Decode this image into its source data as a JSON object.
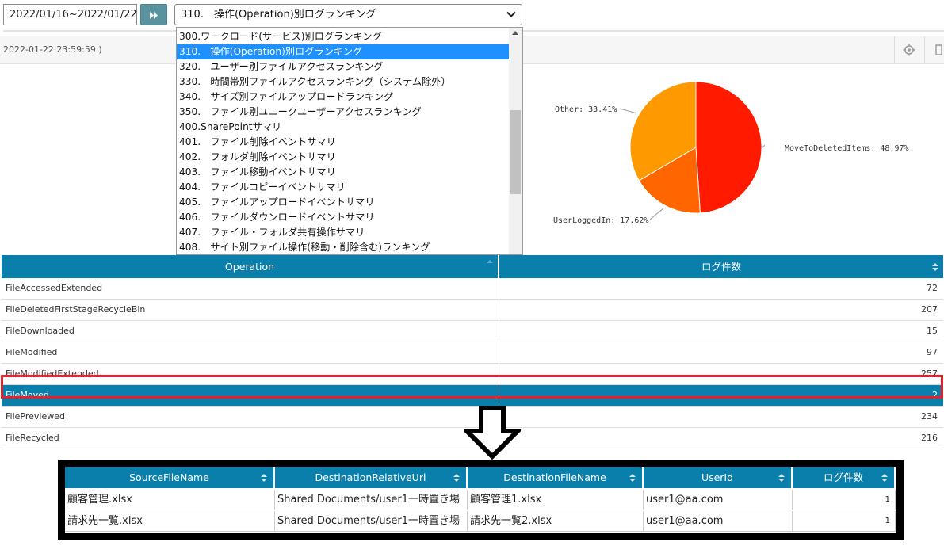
{
  "toolbar": {
    "date_range": "2022/01/16~2022/01/22",
    "selected_report": "310.　操作(Operation)別ログランキング"
  },
  "info_bar": {
    "timestamp": "2022-01-22 23:59:59 )"
  },
  "dropdown": {
    "items": [
      "300.ワークロード(サービス)別ログランキング",
      "310.　操作(Operation)別ログランキング",
      "320.　ユーザー別ファイルアクセスランキング",
      "330.　時間帯別ファイルアクセスランキング（システム除外）",
      "340.　サイズ別ファイルアップロードランキング",
      "350.　ファイル別ユニークユーザーアクセスランキング",
      "400.SharePointサマリ",
      "401.　ファイル削除イベントサマリ",
      "402.　フォルダ削除イベントサマリ",
      "403.　ファイル移動イベントサマリ",
      "404.　ファイルコピーイベントサマリ",
      "405.　ファイルアップロードイベントサマリ",
      "406.　ファイルダウンロードイベントサマリ",
      "407.　ファイル・フォルダ共有操作サマリ",
      "408.　サイト別ファイル操作(移動・削除含む)ランキング"
    ],
    "selected_index": 1
  },
  "chart_data": {
    "type": "pie",
    "slices": [
      {
        "label": "MoveToDeletedItems: 48.97%",
        "value": 48.97,
        "color": "#ff1a00"
      },
      {
        "label": "UserLoggedIn: 17.62%",
        "value": 17.62,
        "color": "#ff6600"
      },
      {
        "label": "Other: 33.41%",
        "value": 33.41,
        "color": "#ff9900"
      }
    ]
  },
  "main_table": {
    "headers": [
      "Operation",
      "ログ件数"
    ],
    "rows": [
      [
        "FileAccessedExtended",
        "72"
      ],
      [
        "FileDeletedFirstStageRecycleBin",
        "207"
      ],
      [
        "FileDownloaded",
        "15"
      ],
      [
        "FileModified",
        "97"
      ],
      [
        "FileModifiedExtended",
        "257"
      ],
      [
        "FileMoved",
        "2"
      ],
      [
        "FilePreviewed",
        "234"
      ],
      [
        "FileRecycled",
        "216"
      ]
    ],
    "selected_row": 5
  },
  "detail_table": {
    "headers": [
      "SourceFileName",
      "DestinationRelativeUrl",
      "DestinationFileName",
      "UserId",
      "ログ件数"
    ],
    "rows": [
      [
        "顧客管理.xlsx",
        "Shared Documents/user1一時置き場",
        "顧客管理1.xlsx",
        "user1@aa.com",
        "1"
      ],
      [
        "請求先一覧.xlsx",
        "Shared Documents/user1一時置き場",
        "請求先一覧2.xlsx",
        "user1@aa.com",
        "1"
      ]
    ]
  },
  "colors": {
    "header_blue": "#0b7fab",
    "highlight_red": "#e8202a",
    "selected_blue": "#1e90ff"
  }
}
